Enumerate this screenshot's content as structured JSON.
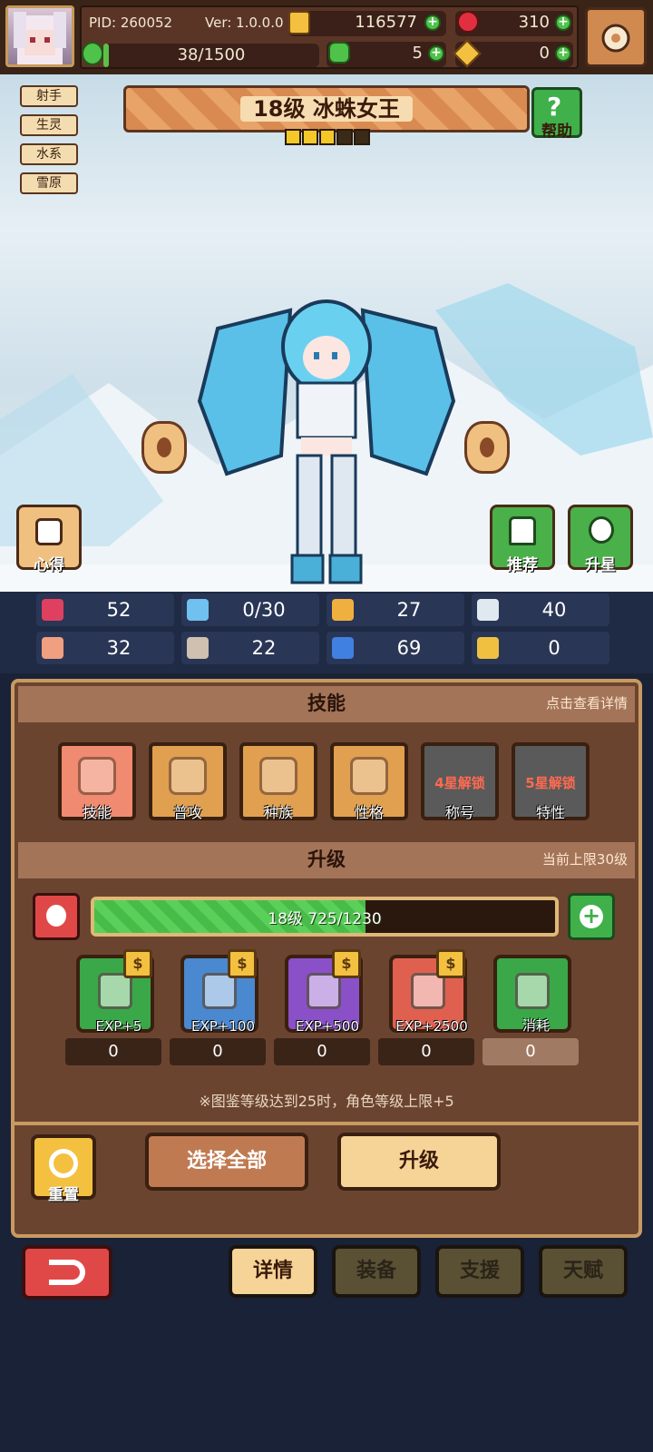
{
  "header": {
    "pid": "PID: 260052",
    "version": "Ver: 1.0.0.0",
    "gold": "116577",
    "gems": "310",
    "stamina": "38/1500",
    "stamina_fraction": 0.025,
    "clover": "5",
    "keys": "0"
  },
  "hero": {
    "title": "18级 冰蛛女王",
    "stars_filled": 3,
    "stars_total": 5,
    "tags": [
      "射手",
      "生灵",
      "水系",
      "雪原"
    ],
    "help_label": "帮助",
    "notes_label": "心得",
    "recommend_label": "推荐",
    "star_up_label": "升星"
  },
  "stats": [
    {
      "icon": "heart-icon",
      "value": "52",
      "color": "#e04060"
    },
    {
      "icon": "water-drop-icon",
      "value": "0/30",
      "color": "#70c0f0"
    },
    {
      "icon": "shield-icon",
      "value": "27",
      "color": "#f0b040"
    },
    {
      "icon": "wing-icon",
      "value": "40",
      "color": "#e0e8f0"
    },
    {
      "icon": "fist-icon",
      "value": "32",
      "color": "#f0a080"
    },
    {
      "icon": "book-icon",
      "value": "22",
      "color": "#d0c0b0"
    },
    {
      "icon": "scroll-icon",
      "value": "69",
      "color": "#4080e0"
    },
    {
      "icon": "horseshoe-icon",
      "value": "0",
      "color": "#f0c040"
    }
  ],
  "skills_section": {
    "title": "技能",
    "hint": "点击查看详情",
    "items": [
      {
        "label": "技能",
        "lock": "",
        "bg": "#f08a70"
      },
      {
        "label": "普攻",
        "lock": "",
        "bg": "#e0a050"
      },
      {
        "label": "种族",
        "lock": "",
        "bg": "#e0a050"
      },
      {
        "label": "性格",
        "lock": "",
        "bg": "#e0a050"
      },
      {
        "label": "称号",
        "lock": "4星解锁",
        "bg": "#5a5a5a"
      },
      {
        "label": "特性",
        "lock": "5星解锁",
        "bg": "#5a5a5a"
      }
    ]
  },
  "upgrade_section": {
    "title": "升级",
    "hint": "当前上限30级",
    "xp_text": "18级  725/1230",
    "xp_fraction": 0.589,
    "items": [
      {
        "label": "EXP+5",
        "count": "0",
        "bg": "#3aa848",
        "coin": "$"
      },
      {
        "label": "EXP+100",
        "count": "0",
        "bg": "#4a88d0",
        "coin": "$"
      },
      {
        "label": "EXP+500",
        "count": "0",
        "bg": "#8a50c8",
        "coin": "$"
      },
      {
        "label": "EXP+2500",
        "count": "0",
        "bg": "#e06050",
        "coin": "$"
      },
      {
        "label": "消耗",
        "count": "0",
        "bg": "#3aa848",
        "coin": ""
      }
    ],
    "note": "※图鉴等级达到25时，角色等级上限+5"
  },
  "actions": {
    "reset_label": "重置",
    "select_all_label": "选择全部",
    "upgrade_label": "升级"
  },
  "nav": {
    "tabs": [
      "详情",
      "装备",
      "支援",
      "天赋"
    ]
  }
}
